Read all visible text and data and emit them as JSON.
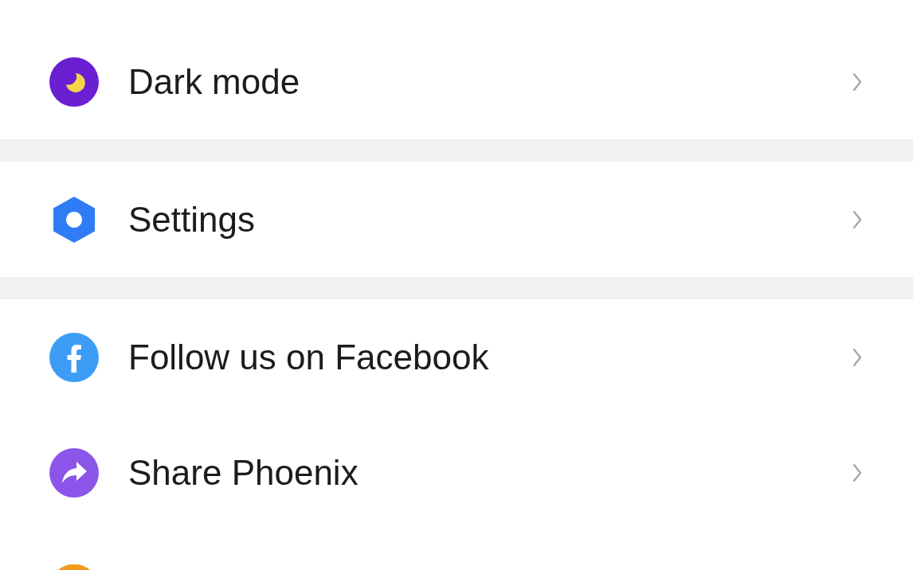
{
  "sections": [
    {
      "items": [
        {
          "kind": "moon",
          "label": "Dark mode"
        }
      ]
    },
    {
      "items": [
        {
          "kind": "hexagon",
          "label": "Settings"
        }
      ]
    },
    {
      "items": [
        {
          "kind": "facebook",
          "label": "Follow us on Facebook"
        },
        {
          "kind": "share",
          "label": "Share Phoenix"
        },
        {
          "kind": "clipped"
        }
      ]
    }
  ]
}
